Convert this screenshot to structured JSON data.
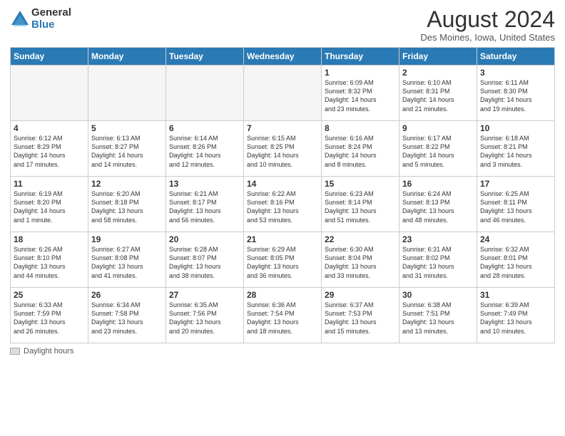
{
  "logo": {
    "general": "General",
    "blue": "Blue"
  },
  "calendar": {
    "title": "August 2024",
    "subtitle": "Des Moines, Iowa, United States"
  },
  "weekdays": [
    "Sunday",
    "Monday",
    "Tuesday",
    "Wednesday",
    "Thursday",
    "Friday",
    "Saturday"
  ],
  "weeks": [
    [
      {
        "day": "",
        "info": ""
      },
      {
        "day": "",
        "info": ""
      },
      {
        "day": "",
        "info": ""
      },
      {
        "day": "",
        "info": ""
      },
      {
        "day": "1",
        "info": "Sunrise: 6:09 AM\nSunset: 8:32 PM\nDaylight: 14 hours\nand 23 minutes."
      },
      {
        "day": "2",
        "info": "Sunrise: 6:10 AM\nSunset: 8:31 PM\nDaylight: 14 hours\nand 21 minutes."
      },
      {
        "day": "3",
        "info": "Sunrise: 6:11 AM\nSunset: 8:30 PM\nDaylight: 14 hours\nand 19 minutes."
      }
    ],
    [
      {
        "day": "4",
        "info": "Sunrise: 6:12 AM\nSunset: 8:29 PM\nDaylight: 14 hours\nand 17 minutes."
      },
      {
        "day": "5",
        "info": "Sunrise: 6:13 AM\nSunset: 8:27 PM\nDaylight: 14 hours\nand 14 minutes."
      },
      {
        "day": "6",
        "info": "Sunrise: 6:14 AM\nSunset: 8:26 PM\nDaylight: 14 hours\nand 12 minutes."
      },
      {
        "day": "7",
        "info": "Sunrise: 6:15 AM\nSunset: 8:25 PM\nDaylight: 14 hours\nand 10 minutes."
      },
      {
        "day": "8",
        "info": "Sunrise: 6:16 AM\nSunset: 8:24 PM\nDaylight: 14 hours\nand 8 minutes."
      },
      {
        "day": "9",
        "info": "Sunrise: 6:17 AM\nSunset: 8:22 PM\nDaylight: 14 hours\nand 5 minutes."
      },
      {
        "day": "10",
        "info": "Sunrise: 6:18 AM\nSunset: 8:21 PM\nDaylight: 14 hours\nand 3 minutes."
      }
    ],
    [
      {
        "day": "11",
        "info": "Sunrise: 6:19 AM\nSunset: 8:20 PM\nDaylight: 14 hours\nand 1 minute."
      },
      {
        "day": "12",
        "info": "Sunrise: 6:20 AM\nSunset: 8:18 PM\nDaylight: 13 hours\nand 58 minutes."
      },
      {
        "day": "13",
        "info": "Sunrise: 6:21 AM\nSunset: 8:17 PM\nDaylight: 13 hours\nand 56 minutes."
      },
      {
        "day": "14",
        "info": "Sunrise: 6:22 AM\nSunset: 8:16 PM\nDaylight: 13 hours\nand 53 minutes."
      },
      {
        "day": "15",
        "info": "Sunrise: 6:23 AM\nSunset: 8:14 PM\nDaylight: 13 hours\nand 51 minutes."
      },
      {
        "day": "16",
        "info": "Sunrise: 6:24 AM\nSunset: 8:13 PM\nDaylight: 13 hours\nand 48 minutes."
      },
      {
        "day": "17",
        "info": "Sunrise: 6:25 AM\nSunset: 8:11 PM\nDaylight: 13 hours\nand 46 minutes."
      }
    ],
    [
      {
        "day": "18",
        "info": "Sunrise: 6:26 AM\nSunset: 8:10 PM\nDaylight: 13 hours\nand 44 minutes."
      },
      {
        "day": "19",
        "info": "Sunrise: 6:27 AM\nSunset: 8:08 PM\nDaylight: 13 hours\nand 41 minutes."
      },
      {
        "day": "20",
        "info": "Sunrise: 6:28 AM\nSunset: 8:07 PM\nDaylight: 13 hours\nand 38 minutes."
      },
      {
        "day": "21",
        "info": "Sunrise: 6:29 AM\nSunset: 8:05 PM\nDaylight: 13 hours\nand 36 minutes."
      },
      {
        "day": "22",
        "info": "Sunrise: 6:30 AM\nSunset: 8:04 PM\nDaylight: 13 hours\nand 33 minutes."
      },
      {
        "day": "23",
        "info": "Sunrise: 6:31 AM\nSunset: 8:02 PM\nDaylight: 13 hours\nand 31 minutes."
      },
      {
        "day": "24",
        "info": "Sunrise: 6:32 AM\nSunset: 8:01 PM\nDaylight: 13 hours\nand 28 minutes."
      }
    ],
    [
      {
        "day": "25",
        "info": "Sunrise: 6:33 AM\nSunset: 7:59 PM\nDaylight: 13 hours\nand 26 minutes."
      },
      {
        "day": "26",
        "info": "Sunrise: 6:34 AM\nSunset: 7:58 PM\nDaylight: 13 hours\nand 23 minutes."
      },
      {
        "day": "27",
        "info": "Sunrise: 6:35 AM\nSunset: 7:56 PM\nDaylight: 13 hours\nand 20 minutes."
      },
      {
        "day": "28",
        "info": "Sunrise: 6:36 AM\nSunset: 7:54 PM\nDaylight: 13 hours\nand 18 minutes."
      },
      {
        "day": "29",
        "info": "Sunrise: 6:37 AM\nSunset: 7:53 PM\nDaylight: 13 hours\nand 15 minutes."
      },
      {
        "day": "30",
        "info": "Sunrise: 6:38 AM\nSunset: 7:51 PM\nDaylight: 13 hours\nand 13 minutes."
      },
      {
        "day": "31",
        "info": "Sunrise: 6:39 AM\nSunset: 7:49 PM\nDaylight: 13 hours\nand 10 minutes."
      }
    ]
  ],
  "footer": {
    "label": "Daylight hours"
  }
}
